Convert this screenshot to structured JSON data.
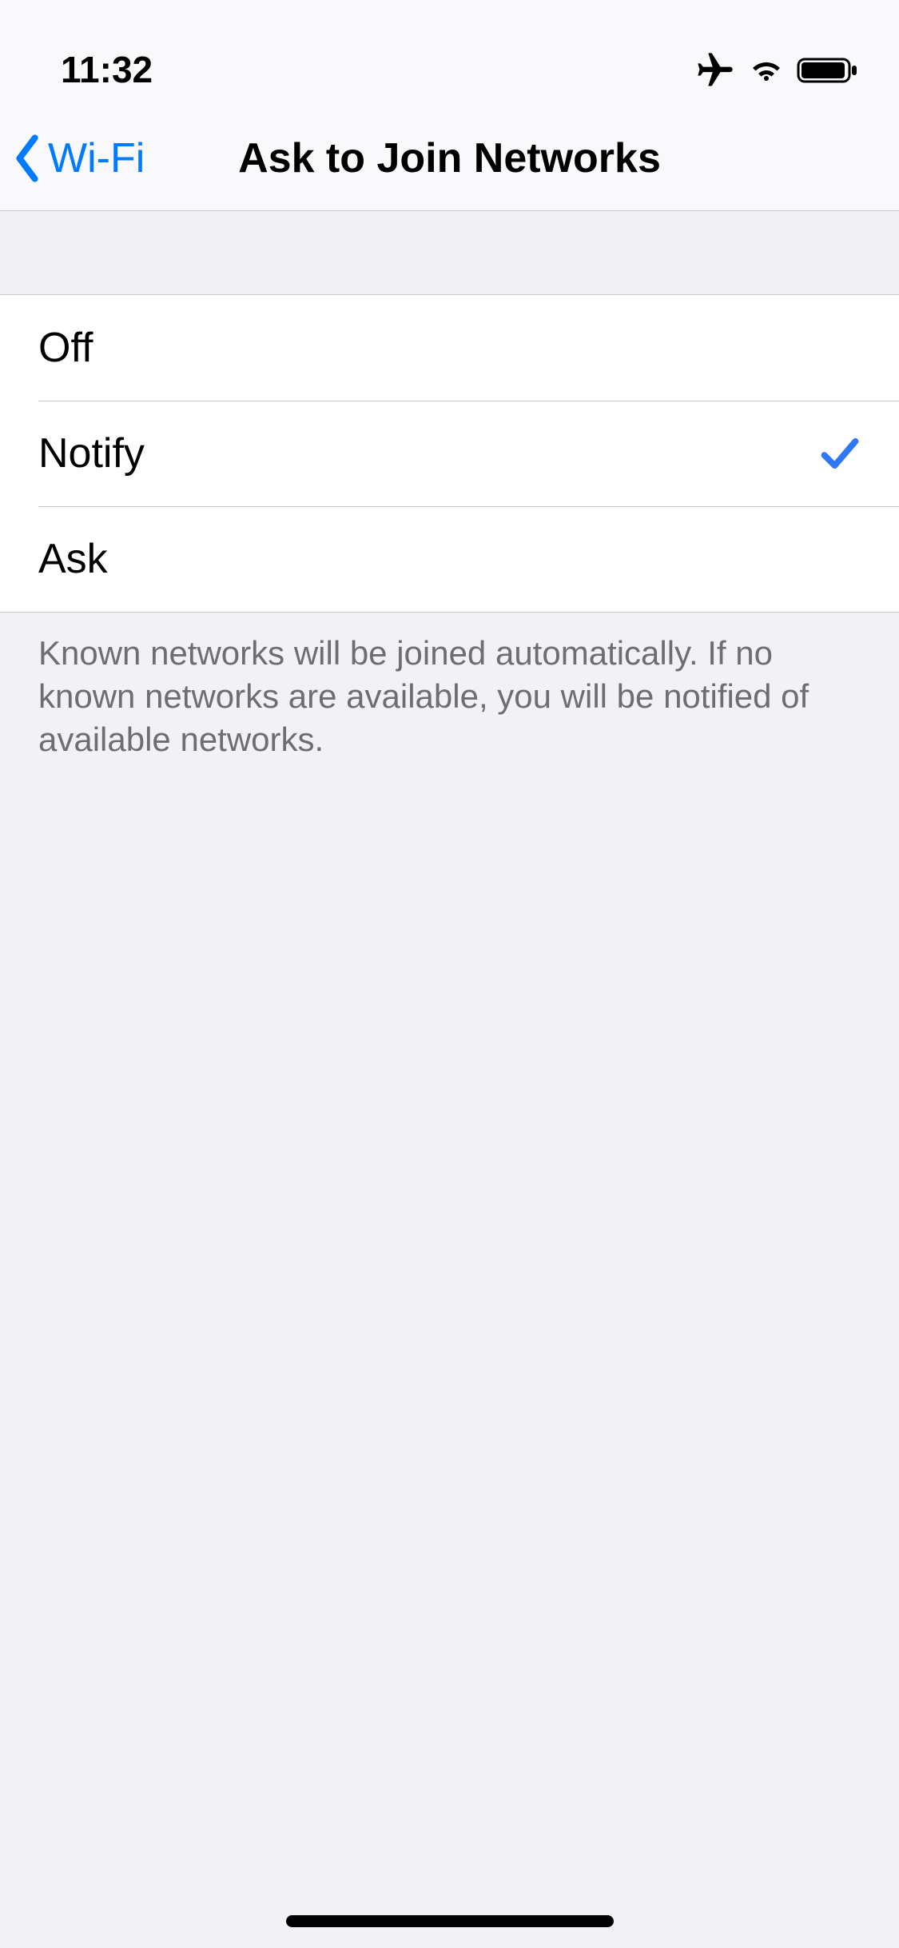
{
  "status": {
    "time": "11:32"
  },
  "nav": {
    "back_label": "Wi-Fi",
    "title": "Ask to Join Networks"
  },
  "options": [
    {
      "label": "Off",
      "selected": false
    },
    {
      "label": "Notify",
      "selected": true
    },
    {
      "label": "Ask",
      "selected": false
    }
  ],
  "footer": {
    "note": "Known networks will be joined automatically. If no known networks are available, you will be notified of available networks."
  }
}
